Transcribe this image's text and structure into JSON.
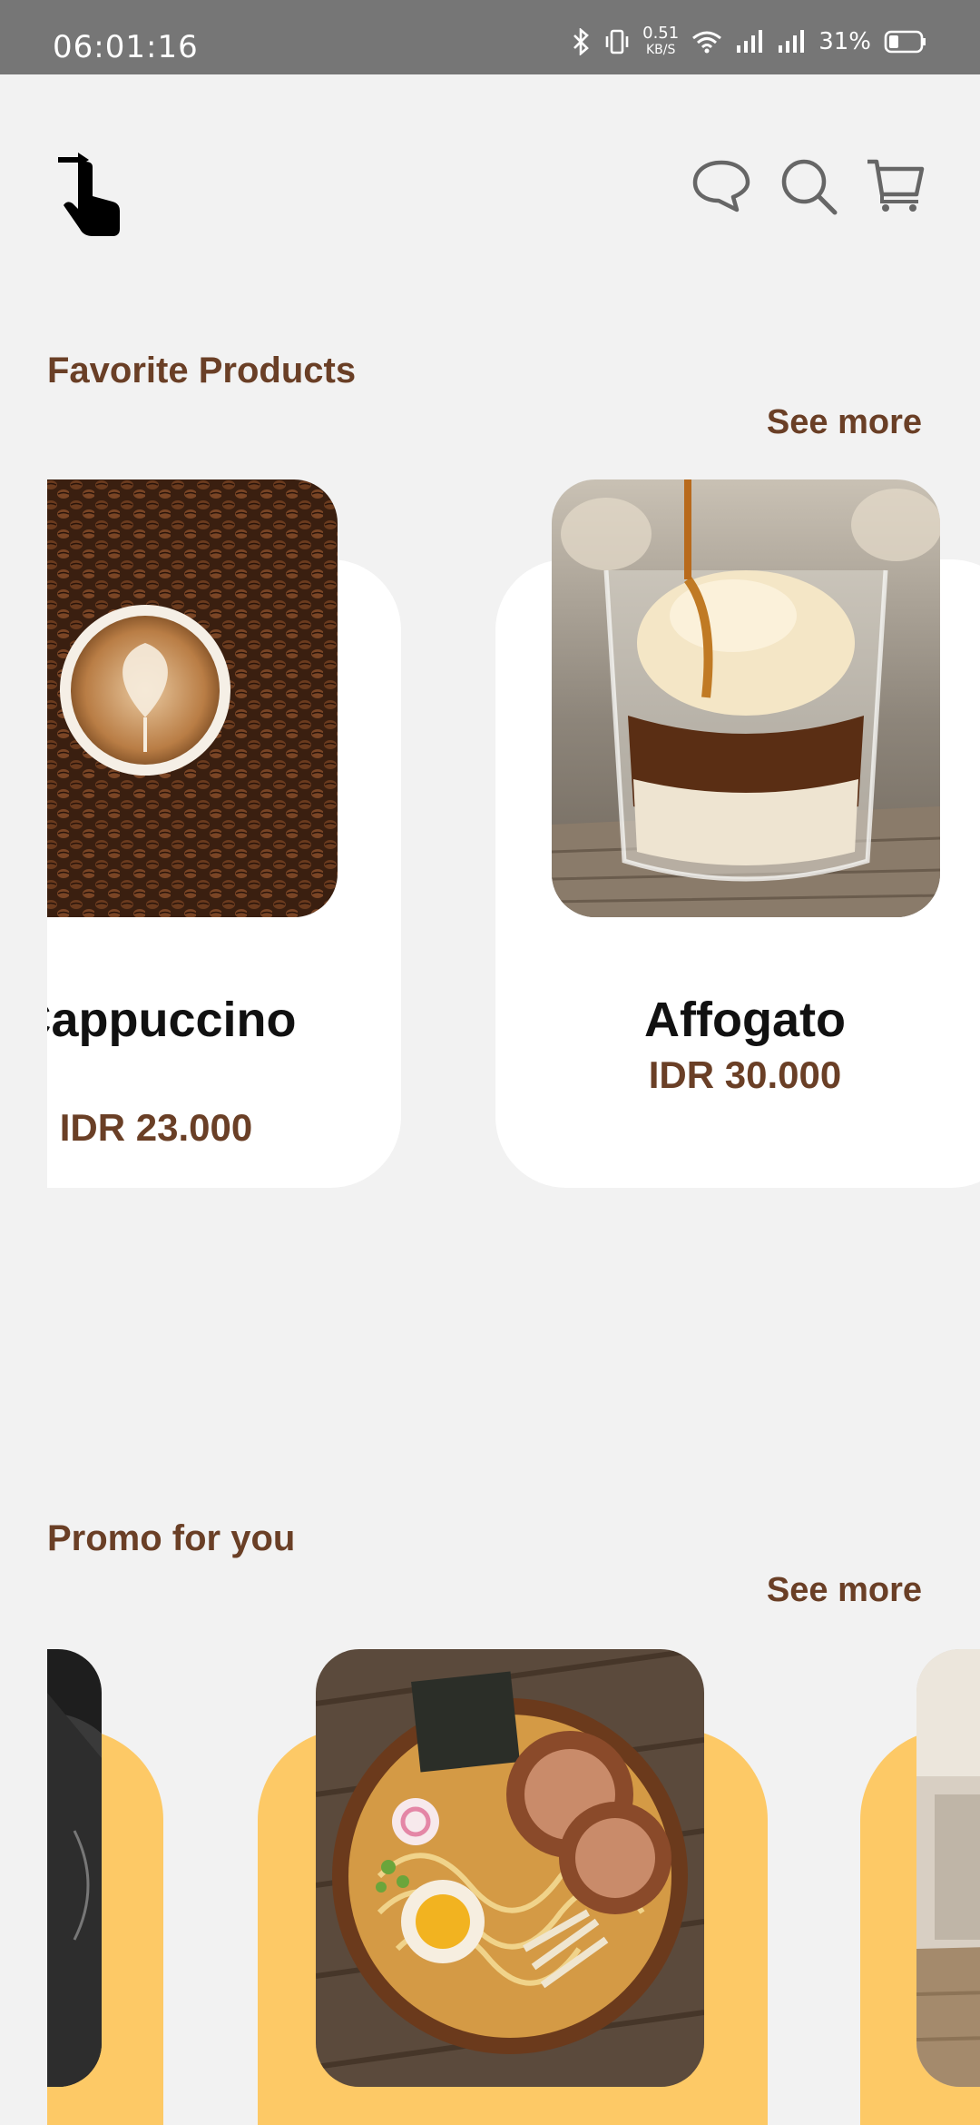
{
  "status_bar": {
    "time": "06:01:16",
    "network_speed_value": "0.51",
    "network_speed_unit": "KB/S",
    "battery_percent": "31%",
    "icons": [
      "bluetooth-icon",
      "vibrate-icon",
      "wifi-icon",
      "signal-icon",
      "signal-icon",
      "battery-icon"
    ]
  },
  "app_bar": {
    "logo_icon": "tap-pointer-icon",
    "actions": [
      "chat-icon",
      "search-icon",
      "cart-icon"
    ]
  },
  "favorite_section": {
    "title": "Favorite Products",
    "see_more": "See more",
    "products": [
      {
        "name": "Cappuccino",
        "price": "IDR 23.000"
      },
      {
        "name": "Affogato",
        "price": "IDR 30.000"
      }
    ]
  },
  "promo_section": {
    "title": "Promo for you",
    "see_more": "See more"
  },
  "colors": {
    "background": "#f2f2f2",
    "accent_brown": "#6a3f26",
    "promo_card": "#fdc966",
    "status_bar": "#767676"
  }
}
